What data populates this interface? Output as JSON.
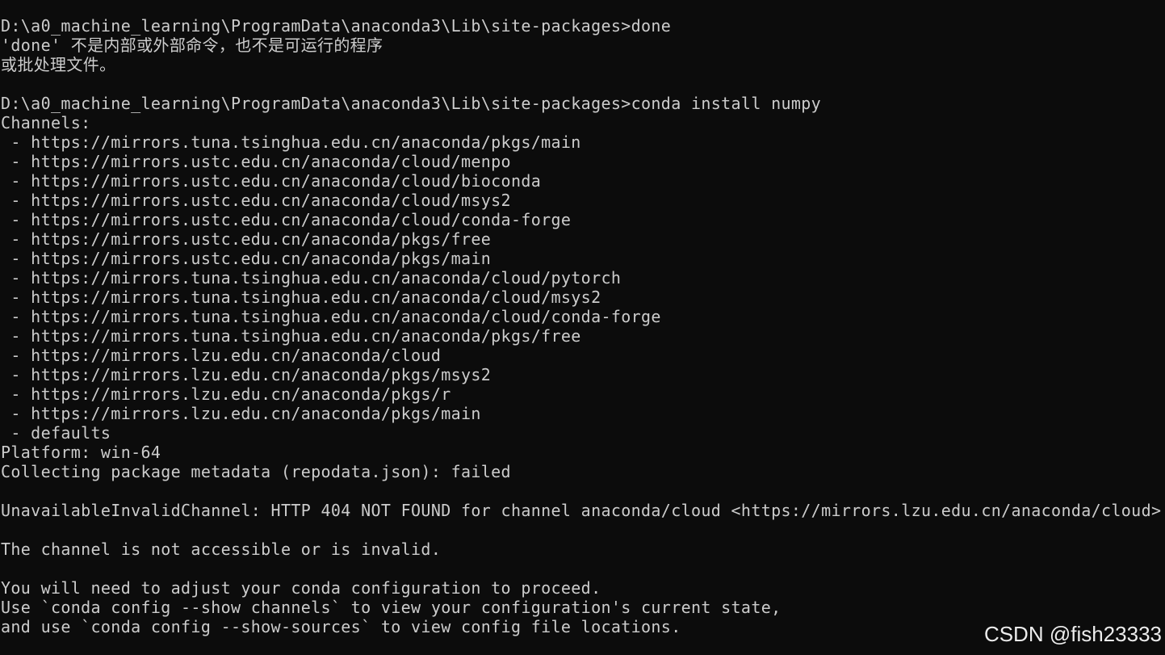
{
  "console": {
    "lines": [
      {
        "text": "D:\\a0_machine_learning\\ProgramData\\anaconda3\\Lib\\site-packages>done"
      },
      {
        "text": "'done' 不是内部或外部命令，也不是可运行的程序"
      },
      {
        "text": "或批处理文件。"
      },
      {
        "text": ""
      },
      {
        "text": "D:\\a0_machine_learning\\ProgramData\\anaconda3\\Lib\\site-packages>conda install numpy"
      },
      {
        "text": "Channels:"
      },
      {
        "text": " - https://mirrors.tuna.tsinghua.edu.cn/anaconda/pkgs/main"
      },
      {
        "text": " - https://mirrors.ustc.edu.cn/anaconda/cloud/menpo"
      },
      {
        "text": " - https://mirrors.ustc.edu.cn/anaconda/cloud/bioconda"
      },
      {
        "text": " - https://mirrors.ustc.edu.cn/anaconda/cloud/msys2"
      },
      {
        "text": " - https://mirrors.ustc.edu.cn/anaconda/cloud/conda-forge"
      },
      {
        "text": " - https://mirrors.ustc.edu.cn/anaconda/pkgs/free"
      },
      {
        "text": " - https://mirrors.ustc.edu.cn/anaconda/pkgs/main"
      },
      {
        "text": " - https://mirrors.tuna.tsinghua.edu.cn/anaconda/cloud/pytorch"
      },
      {
        "text": " - https://mirrors.tuna.tsinghua.edu.cn/anaconda/cloud/msys2"
      },
      {
        "text": " - https://mirrors.tuna.tsinghua.edu.cn/anaconda/cloud/conda-forge"
      },
      {
        "text": " - https://mirrors.tuna.tsinghua.edu.cn/anaconda/pkgs/free"
      },
      {
        "text": " - https://mirrors.lzu.edu.cn/anaconda/cloud"
      },
      {
        "text": " - https://mirrors.lzu.edu.cn/anaconda/pkgs/msys2"
      },
      {
        "text": " - https://mirrors.lzu.edu.cn/anaconda/pkgs/r"
      },
      {
        "text": " - https://mirrors.lzu.edu.cn/anaconda/pkgs/main"
      },
      {
        "text": " - defaults"
      },
      {
        "text": "Platform: win-64"
      },
      {
        "text": "Collecting package metadata (repodata.json): failed"
      },
      {
        "text": ""
      },
      {
        "text": "UnavailableInvalidChannel: HTTP 404 NOT FOUND for channel anaconda/cloud <https://mirrors.lzu.edu.cn/anaconda/cloud>"
      },
      {
        "text": ""
      },
      {
        "text": "The channel is not accessible or is invalid."
      },
      {
        "text": ""
      },
      {
        "text": "You will need to adjust your conda configuration to proceed."
      },
      {
        "text": "Use `conda config --show channels` to view your configuration's current state,"
      },
      {
        "text": "and use `conda config --show-sources` to view config file locations."
      }
    ]
  },
  "watermark": {
    "text": "CSDN @fish23333"
  },
  "colors": {
    "background": "#0c0c0c",
    "text": "#cccccc",
    "watermark": "#ffffff"
  }
}
